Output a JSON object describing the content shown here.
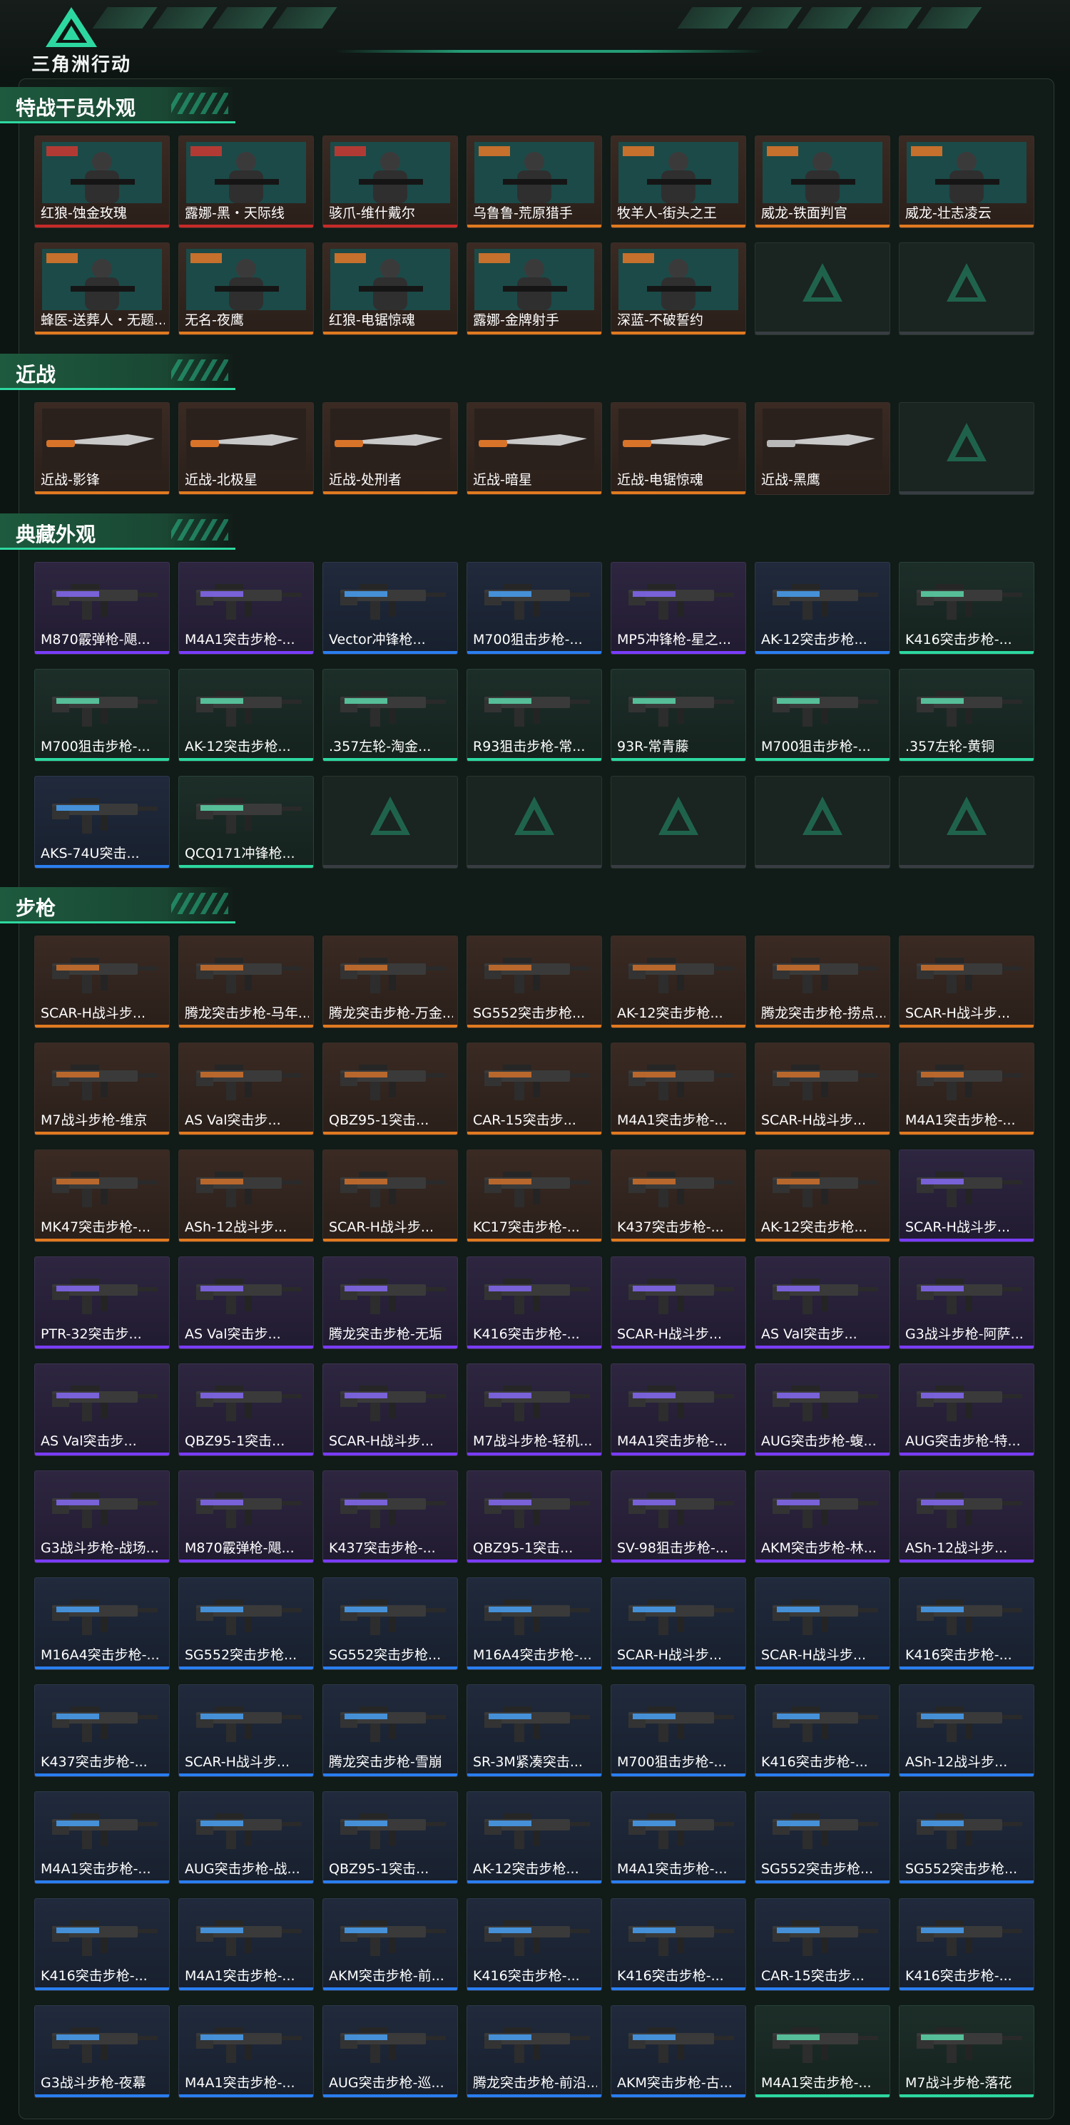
{
  "app": {
    "logo_text": "三角洲行动"
  },
  "sections": [
    {
      "title": "特战干员外观",
      "items": [
        {
          "name": "红狼-蚀金玫瑰",
          "rarity": "red",
          "kind": "operator"
        },
        {
          "name": "露娜-黑・天际线",
          "rarity": "red",
          "kind": "operator"
        },
        {
          "name": "骇爪-维什戴尔",
          "rarity": "red",
          "kind": "operator"
        },
        {
          "name": "乌鲁鲁-荒原猎手",
          "rarity": "orange",
          "kind": "operator"
        },
        {
          "name": "牧羊人-街头之王",
          "rarity": "orange",
          "kind": "operator"
        },
        {
          "name": "威龙-铁面判官",
          "rarity": "orange",
          "kind": "operator"
        },
        {
          "name": "威龙-壮志凌云",
          "rarity": "orange",
          "kind": "operator"
        },
        {
          "name": "蜂医-送葬人・无题...",
          "rarity": "orange",
          "kind": "operator"
        },
        {
          "name": "无名-夜鹰",
          "rarity": "orange",
          "kind": "operator"
        },
        {
          "name": "红狼-电锯惊魂",
          "rarity": "orange",
          "kind": "operator"
        },
        {
          "name": "露娜-金牌射手",
          "rarity": "orange",
          "kind": "operator"
        },
        {
          "name": "深蓝-不破誓约",
          "rarity": "orange",
          "kind": "operator"
        },
        {
          "name": "",
          "rarity": "empty"
        },
        {
          "name": "",
          "rarity": "empty"
        }
      ]
    },
    {
      "title": "近战",
      "items": [
        {
          "name": "近战-影锋",
          "rarity": "orange",
          "kind": "melee"
        },
        {
          "name": "近战-北极星",
          "rarity": "orange",
          "kind": "melee"
        },
        {
          "name": "近战-处刑者",
          "rarity": "orange",
          "kind": "melee"
        },
        {
          "name": "近战-暗星",
          "rarity": "orange",
          "kind": "melee"
        },
        {
          "name": "近战-电锯惊魂",
          "rarity": "orange",
          "kind": "melee"
        },
        {
          "name": "近战-黑鹰",
          "rarity": "gray",
          "kind": "melee"
        },
        {
          "name": "",
          "rarity": "empty"
        }
      ]
    },
    {
      "title": "典藏外观",
      "items": [
        {
          "name": "M870霰弹枪-飓...",
          "rarity": "purple",
          "kind": "gun"
        },
        {
          "name": "M4A1突击步枪-...",
          "rarity": "purple",
          "kind": "gun"
        },
        {
          "name": "Vector冲锋枪...",
          "rarity": "blue",
          "kind": "gun"
        },
        {
          "name": "M700狙击步枪-...",
          "rarity": "blue",
          "kind": "gun"
        },
        {
          "name": "MP5冲锋枪-星之...",
          "rarity": "purple",
          "kind": "gun"
        },
        {
          "name": "AK-12突击步枪...",
          "rarity": "blue",
          "kind": "gun"
        },
        {
          "name": "K416突击步枪-...",
          "rarity": "green",
          "kind": "gun"
        },
        {
          "name": "M700狙击步枪-...",
          "rarity": "green",
          "kind": "gun"
        },
        {
          "name": "AK-12突击步枪...",
          "rarity": "green",
          "kind": "gun"
        },
        {
          "name": ".357左轮-淘金...",
          "rarity": "green",
          "kind": "gun"
        },
        {
          "name": "R93狙击步枪-常...",
          "rarity": "green",
          "kind": "gun"
        },
        {
          "name": "93R-常青藤",
          "rarity": "green",
          "kind": "gun"
        },
        {
          "name": "M700狙击步枪-...",
          "rarity": "green",
          "kind": "gun"
        },
        {
          "name": ".357左轮-黄铜",
          "rarity": "green",
          "kind": "gun"
        },
        {
          "name": "AKS-74U突击...",
          "rarity": "blue",
          "kind": "gun"
        },
        {
          "name": "QCQ171冲锋枪...",
          "rarity": "green",
          "kind": "gun"
        },
        {
          "name": "",
          "rarity": "empty"
        },
        {
          "name": "",
          "rarity": "empty"
        },
        {
          "name": "",
          "rarity": "empty"
        },
        {
          "name": "",
          "rarity": "empty"
        },
        {
          "name": "",
          "rarity": "empty"
        }
      ]
    },
    {
      "title": "步枪",
      "items": [
        {
          "name": "SCAR-H战斗步...",
          "rarity": "orange",
          "kind": "gun"
        },
        {
          "name": "腾龙突击步枪-马年...",
          "rarity": "orange",
          "kind": "gun"
        },
        {
          "name": "腾龙突击步枪-万金...",
          "rarity": "orange",
          "kind": "gun"
        },
        {
          "name": "SG552突击步枪...",
          "rarity": "orange",
          "kind": "gun"
        },
        {
          "name": "AK-12突击步枪...",
          "rarity": "orange",
          "kind": "gun"
        },
        {
          "name": "腾龙突击步枪-捞点...",
          "rarity": "orange",
          "kind": "gun"
        },
        {
          "name": "SCAR-H战斗步...",
          "rarity": "orange",
          "kind": "gun"
        },
        {
          "name": "M7战斗步枪-维京",
          "rarity": "orange",
          "kind": "gun"
        },
        {
          "name": "AS Val突击步...",
          "rarity": "orange",
          "kind": "gun"
        },
        {
          "name": "QBZ95-1突击...",
          "rarity": "orange",
          "kind": "gun"
        },
        {
          "name": "CAR-15突击步...",
          "rarity": "orange",
          "kind": "gun"
        },
        {
          "name": "M4A1突击步枪-...",
          "rarity": "orange",
          "kind": "gun"
        },
        {
          "name": "SCAR-H战斗步...",
          "rarity": "orange",
          "kind": "gun"
        },
        {
          "name": "M4A1突击步枪-...",
          "rarity": "orange",
          "kind": "gun"
        },
        {
          "name": "MK47突击步枪-...",
          "rarity": "orange",
          "kind": "gun"
        },
        {
          "name": "ASh-12战斗步...",
          "rarity": "orange",
          "kind": "gun"
        },
        {
          "name": "SCAR-H战斗步...",
          "rarity": "orange",
          "kind": "gun"
        },
        {
          "name": "KC17突击步枪-...",
          "rarity": "orange",
          "kind": "gun"
        },
        {
          "name": "K437突击步枪-...",
          "rarity": "orange",
          "kind": "gun"
        },
        {
          "name": "AK-12突击步枪...",
          "rarity": "orange",
          "kind": "gun"
        },
        {
          "name": "SCAR-H战斗步...",
          "rarity": "purple",
          "kind": "gun"
        },
        {
          "name": "PTR-32突击步...",
          "rarity": "purple",
          "kind": "gun"
        },
        {
          "name": "AS Val突击步...",
          "rarity": "purple",
          "kind": "gun"
        },
        {
          "name": "腾龙突击步枪-无垢",
          "rarity": "purple",
          "kind": "gun"
        },
        {
          "name": "K416突击步枪-...",
          "rarity": "purple",
          "kind": "gun"
        },
        {
          "name": "SCAR-H战斗步...",
          "rarity": "purple",
          "kind": "gun"
        },
        {
          "name": "AS Val突击步...",
          "rarity": "purple",
          "kind": "gun"
        },
        {
          "name": "G3战斗步枪-阿萨...",
          "rarity": "purple",
          "kind": "gun"
        },
        {
          "name": "AS Val突击步...",
          "rarity": "purple",
          "kind": "gun"
        },
        {
          "name": "QBZ95-1突击...",
          "rarity": "purple",
          "kind": "gun"
        },
        {
          "name": "SCAR-H战斗步...",
          "rarity": "purple",
          "kind": "gun"
        },
        {
          "name": "M7战斗步枪-轻机...",
          "rarity": "purple",
          "kind": "gun"
        },
        {
          "name": "M4A1突击步枪-...",
          "rarity": "purple",
          "kind": "gun"
        },
        {
          "name": "AUG突击步枪-蝮...",
          "rarity": "purple",
          "kind": "gun"
        },
        {
          "name": "AUG突击步枪-特...",
          "rarity": "purple",
          "kind": "gun"
        },
        {
          "name": "G3战斗步枪-战场...",
          "rarity": "purple",
          "kind": "gun"
        },
        {
          "name": "M870霰弹枪-飓...",
          "rarity": "purple",
          "kind": "gun"
        },
        {
          "name": "K437突击步枪-...",
          "rarity": "purple",
          "kind": "gun"
        },
        {
          "name": "QBZ95-1突击...",
          "rarity": "purple",
          "kind": "gun"
        },
        {
          "name": "SV-98狙击步枪-...",
          "rarity": "purple",
          "kind": "gun"
        },
        {
          "name": "AKM突击步枪-林...",
          "rarity": "purple",
          "kind": "gun"
        },
        {
          "name": "ASh-12战斗步...",
          "rarity": "purple",
          "kind": "gun"
        },
        {
          "name": "M16A4突击步枪-...",
          "rarity": "blue",
          "kind": "gun"
        },
        {
          "name": "SG552突击步枪...",
          "rarity": "blue",
          "kind": "gun"
        },
        {
          "name": "SG552突击步枪...",
          "rarity": "blue",
          "kind": "gun"
        },
        {
          "name": "M16A4突击步枪-...",
          "rarity": "blue",
          "kind": "gun"
        },
        {
          "name": "SCAR-H战斗步...",
          "rarity": "blue",
          "kind": "gun"
        },
        {
          "name": "SCAR-H战斗步...",
          "rarity": "blue",
          "kind": "gun"
        },
        {
          "name": "K416突击步枪-...",
          "rarity": "blue",
          "kind": "gun"
        },
        {
          "name": "K437突击步枪-...",
          "rarity": "blue",
          "kind": "gun"
        },
        {
          "name": "SCAR-H战斗步...",
          "rarity": "blue",
          "kind": "gun"
        },
        {
          "name": "腾龙突击步枪-雪崩",
          "rarity": "blue",
          "kind": "gun"
        },
        {
          "name": "SR-3M紧凑突击...",
          "rarity": "blue",
          "kind": "gun"
        },
        {
          "name": "M700狙击步枪-...",
          "rarity": "blue",
          "kind": "gun"
        },
        {
          "name": "K416突击步枪-...",
          "rarity": "blue",
          "kind": "gun"
        },
        {
          "name": "ASh-12战斗步...",
          "rarity": "blue",
          "kind": "gun"
        },
        {
          "name": "M4A1突击步枪-...",
          "rarity": "blue",
          "kind": "gun"
        },
        {
          "name": "AUG突击步枪-战...",
          "rarity": "blue",
          "kind": "gun"
        },
        {
          "name": "QBZ95-1突击...",
          "rarity": "blue",
          "kind": "gun"
        },
        {
          "name": "AK-12突击步枪...",
          "rarity": "blue",
          "kind": "gun"
        },
        {
          "name": "M4A1突击步枪-...",
          "rarity": "blue",
          "kind": "gun"
        },
        {
          "name": "SG552突击步枪...",
          "rarity": "blue",
          "kind": "gun"
        },
        {
          "name": "SG552突击步枪...",
          "rarity": "blue",
          "kind": "gun"
        },
        {
          "name": "K416突击步枪-...",
          "rarity": "blue",
          "kind": "gun"
        },
        {
          "name": "M4A1突击步枪-...",
          "rarity": "blue",
          "kind": "gun"
        },
        {
          "name": "AKM突击步枪-前...",
          "rarity": "blue",
          "kind": "gun"
        },
        {
          "name": "K416突击步枪-...",
          "rarity": "blue",
          "kind": "gun"
        },
        {
          "name": "K416突击步枪-...",
          "rarity": "blue",
          "kind": "gun"
        },
        {
          "name": "CAR-15突击步...",
          "rarity": "blue",
          "kind": "gun"
        },
        {
          "name": "K416突击步枪-...",
          "rarity": "blue",
          "kind": "gun"
        },
        {
          "name": "G3战斗步枪-夜幕",
          "rarity": "blue",
          "kind": "gun"
        },
        {
          "name": "M4A1突击步枪-...",
          "rarity": "blue",
          "kind": "gun"
        },
        {
          "name": "AUG突击步枪-巡...",
          "rarity": "blue",
          "kind": "gun"
        },
        {
          "name": "腾龙突击步枪-前沿...",
          "rarity": "blue",
          "kind": "gun"
        },
        {
          "name": "AKM突击步枪-古...",
          "rarity": "blue",
          "kind": "gun"
        },
        {
          "name": "M4A1突击步枪-...",
          "rarity": "green",
          "kind": "gun"
        },
        {
          "name": "M7战斗步枪-落花",
          "rarity": "green",
          "kind": "gun"
        }
      ]
    }
  ]
}
